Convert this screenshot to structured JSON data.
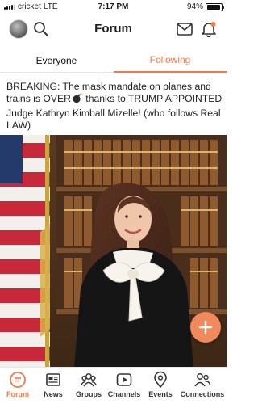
{
  "status_bar": {
    "carrier": "cricket",
    "network": "LTE",
    "time": "7:17 PM",
    "battery": "94%",
    "battery_level": 0.94
  },
  "header": {
    "title": "Forum",
    "icons": [
      "avatar",
      "search-icon",
      "mail-icon",
      "bell-icon"
    ],
    "bell_badge_color": "#f07a4b"
  },
  "tabs": [
    {
      "label": "Everyone",
      "active": false
    },
    {
      "label": "Following",
      "active": true
    }
  ],
  "post": {
    "text_before": "BREAKING: The mask mandate on planes and trains is OVER",
    "text_after": " thanks to TRUMP APPOINTED Judge Kathryn Kimball Mizelle! (who follows Real LAW)",
    "inline_icon": "bomb-icon"
  },
  "fab": {
    "icon": "plus-icon",
    "color": "#f08a5d"
  },
  "bottom_nav": [
    {
      "label": "Forum",
      "icon": "forum-chat-icon",
      "active": true
    },
    {
      "label": "News",
      "icon": "newspaper-icon",
      "active": false
    },
    {
      "label": "Groups",
      "icon": "groups-icon",
      "active": false
    },
    {
      "label": "Channels",
      "icon": "play-icon",
      "active": false
    },
    {
      "label": "Events",
      "icon": "location-pin-icon",
      "active": false
    },
    {
      "label": "Connections",
      "icon": "people-icon",
      "active": false
    }
  ],
  "colors": {
    "accent": "#f07a4b",
    "text": "#222222"
  }
}
